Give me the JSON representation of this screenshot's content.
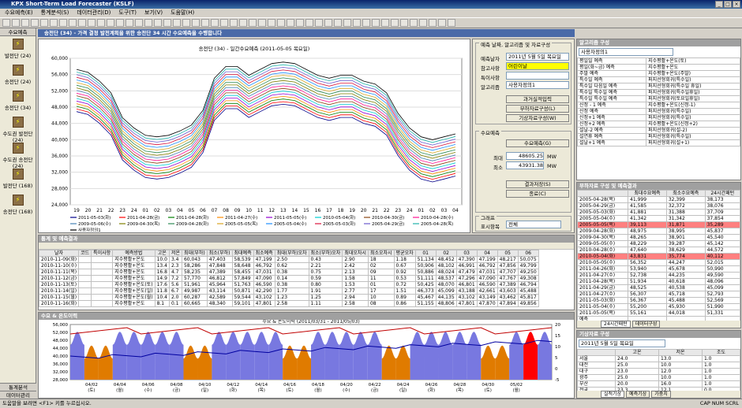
{
  "app": {
    "title": "KPX Short-Term Load Forecaster (KSLF)"
  },
  "menu": [
    "수요예측(E)",
    "통계분석(S)",
    "데이터관리(D)",
    "도구(T)",
    "보기(V)",
    "도움말(H)"
  ],
  "nav": {
    "header": "수요예측",
    "items": [
      "발전단 (24)",
      "송전단 (24)",
      "송전단 (34)",
      "수도권 발전단 (24)",
      "수도권 송전단 (24)",
      "발전단 (168)",
      "송전단 (168)"
    ],
    "footer": [
      "통계분석",
      "데이터관리"
    ]
  },
  "main": {
    "banner": "송전단 (34) - 가격 결정 발전계획을 위한 송전단 34 시간 수요예측을 수행합니다"
  },
  "chart1": {
    "title": "송전단 (34) - 일간수요예측 (2011-05-05 목요일)",
    "ylabels": [
      "24,000",
      "28,000",
      "32,000",
      "36,000",
      "40,000",
      "44,000",
      "48,000",
      "52,000",
      "56,000",
      "60,000"
    ],
    "xlabels": [
      "19",
      "20",
      "21",
      "22",
      "23",
      "24",
      "01",
      "02",
      "03",
      "04",
      "05",
      "06",
      "07",
      "08",
      "09",
      "10",
      "11",
      "12",
      "13",
      "14",
      "15",
      "16",
      "17",
      "18",
      "19",
      "20",
      "21",
      "22",
      "23",
      "24",
      "01",
      "02",
      "03",
      "04"
    ]
  },
  "legend": [
    "2011-05-03(화)",
    "2011-04-28(금)",
    "2011-04-28(화)",
    "2011-04-27(수)",
    "2011-05-05(수)",
    "2010-05-04(화)",
    "2010-04-30(금)",
    "2010-04-28(수)",
    "2009-05-06(수)",
    "2009-04-30(목)",
    "2009-04-28(화)",
    "2005-05-05(목)",
    "2005-05-04(수)",
    "2005-05-03(화)",
    "2005-04-29(금)",
    "2005-04-28(목)",
    "사용자정의1"
  ],
  "forecast_panel": {
    "title": "예측 날짜, 알고리즘 및 자료구성",
    "date_label": "예측날자",
    "date_value": "2011년  5월  5일 목요일",
    "ref_label": "참고사항",
    "ref_value": "어린이날",
    "special_label": "특이사항",
    "algo_label": "알고리즘",
    "algo_value": "사용자정의1",
    "btn_past": "과거실적입력",
    "btn_load": "부하자료구성(L)",
    "btn_temp": "기상자료구성(W)",
    "demand_title": "수요예측",
    "btn_demand": "수요예측(G)",
    "max_label": "최대",
    "max_value": "48605.25",
    "min_label": "최소",
    "min_value": "43931.38",
    "unit": "MW",
    "btn_save": "결과저장(S)",
    "btn_close": "종료(C)",
    "graph_title": "그래프",
    "display_label": "표시항목",
    "display_value": "전체"
  },
  "stats": {
    "title": "통계 및 예측결과",
    "headers": [
      "날자",
      "코드",
      "특이사항",
      "예측방법",
      "고온",
      "저온",
      "최대(부하)",
      "최소(부하)",
      "최대예측",
      "최소예측",
      "최대(부하)오차",
      "최소(부하)오차",
      "최대오차시",
      "최소오차시",
      "평균오차",
      "01",
      "02",
      "03",
      "04",
      "05",
      "06"
    ],
    "rows": [
      [
        "2010-11-09(화)",
        "",
        "",
        "지수평활+온도",
        "10.0",
        "3.4",
        "60,043",
        "47,403",
        "58,539",
        "47,199",
        "2.50",
        "0.43",
        "2.90",
        "18",
        "1.18",
        "51,134",
        "48,452",
        "47,390",
        "47,199",
        "48,217",
        "50,075"
      ],
      [
        "2010-11-10(수)",
        "",
        "",
        "지수평활+온도",
        "13.4",
        "2.3",
        "58,286",
        "47,848",
        "58,648",
        "46,792",
        "0.62",
        "2.21",
        "2.42",
        "02",
        "0.67",
        "50,906",
        "48,102",
        "46,991",
        "46,792",
        "47,856",
        "49,799"
      ],
      [
        "2010-11-11(목)",
        "",
        "",
        "지수평활+온도",
        "16.8",
        "4.7",
        "58,235",
        "47,389",
        "58,455",
        "47,031",
        "0.38",
        "0.75",
        "2.13",
        "09",
        "0.92",
        "50,886",
        "48,024",
        "47,479",
        "47,031",
        "47,707",
        "49,250"
      ],
      [
        "2010-11-12(금)",
        "",
        "",
        "지수평활+온도",
        "14.9",
        "7.2",
        "57,770",
        "46,812",
        "57,849",
        "47,090",
        "0.14",
        "0.59",
        "1.58",
        "11",
        "0.53",
        "51,111",
        "48,537",
        "47,296",
        "47,090",
        "47,767",
        "49,308"
      ],
      [
        "2010-11-13(토)",
        "",
        "",
        "지수평활+온도(토)",
        "17.6",
        "5.6",
        "51,961",
        "45,964",
        "51,763",
        "46,590",
        "0.38",
        "0.80",
        "1.53",
        "01",
        "0.72",
        "50,425",
        "48,070",
        "46,801",
        "46,590",
        "47,389",
        "46,794"
      ],
      [
        "2010-11-14(일)",
        "",
        "",
        "지수평활+온도(일)",
        "11.8",
        "6.7",
        "49,987",
        "43,114",
        "50,871",
        "42,290",
        "1.77",
        "1.91",
        "2.77",
        "17",
        "1.51",
        "46,373",
        "45,099",
        "43,188",
        "42,661",
        "43,603",
        "45,488"
      ],
      [
        "2010-11-15(월)",
        "",
        "",
        "지수평활+온도(월)",
        "10.4",
        "2.0",
        "60,287",
        "42,589",
        "59,544",
        "43,102",
        "1.23",
        "1.25",
        "2.94",
        "10",
        "0.89",
        "45,467",
        "44,135",
        "43,102",
        "43,149",
        "43,462",
        "45,817"
      ],
      [
        "2010-11-16(화)",
        "",
        "",
        "지수평활+온도",
        "8.1",
        "0.1",
        "60,665",
        "48,340",
        "59,101",
        "47,801",
        "2.58",
        "1.11",
        "2.58",
        "08",
        "0.86",
        "51,155",
        "48,806",
        "47,801",
        "47,870",
        "47,894",
        "49,856"
      ]
    ]
  },
  "chart2": {
    "title": "수요 & 온도이력 (2011/03/31 - 2011/05/03)",
    "ylabels": [
      "28,000",
      "32,000",
      "36,000",
      "40,000",
      "44,000",
      "48,000",
      "52,000",
      "56,000"
    ],
    "y2labels": [
      "-5",
      "0",
      "5",
      "10",
      "15",
      "20"
    ],
    "xlabels": [
      "04/02\n(토)",
      "04/04\n(월)",
      "04/06\n(수)",
      "04/08\n(금)",
      "04/10\n(일)",
      "04/12\n(화)",
      "04/14\n(목)",
      "04/16\n(토)",
      "04/18\n(월)",
      "04/20\n(수)",
      "04/22\n(금)",
      "04/24\n(일)",
      "04/26\n(화)",
      "04/28\n(목)",
      "04/30\n(토)",
      "05/02\n(월)"
    ]
  },
  "algo": {
    "title": "알고리즘 구성",
    "dropdown": "사용자정의1",
    "rows": [
      [
        "평일일 예측",
        "지수평활+온도(토)"
      ],
      [
        "평일(화~금) 예측",
        "지수평활+온도"
      ],
      [
        "주말 예측",
        "지수평활+온도(주말)"
      ],
      [
        "특수일 예측",
        "퍼지선형회귀(특수일)"
      ],
      [
        "특수일 다음일 예측",
        "퍼지선형회귀(특수일 휴일)"
      ],
      [
        "특수일 특수일 예측",
        "퍼지선형회귀(특수일휴일)"
      ],
      [
        "특수일 특수일 예측",
        "퍼지선형회귀(토요일휴일)"
      ],
      [
        "신정 - 1 예측",
        "지수평활+온도(신정-1)"
      ],
      [
        "신정 예측",
        "퍼지선형회귀(특수일)"
      ],
      [
        "신정+1 예측",
        "퍼지선형회귀(특수일)"
      ],
      [
        "신정+2 예측",
        "지수평활+온도(신정+2)"
      ],
      [
        "설날-2 예측",
        "퍼지선형회귀(설-2)"
      ],
      [
        "설연휴 예측",
        "퍼지선형회귀(특수일)"
      ],
      [
        "설날+1 예측",
        "퍼지선형회귀(설+1)"
      ]
    ]
  },
  "loaddata": {
    "title": "부하자료 구성 및 예측결과",
    "headers": [
      "",
      "최대수요예측",
      "최소수요예측",
      "24시간패턴"
    ],
    "rows": [
      [
        "2005-04-28(목)",
        "41,999",
        "32,399",
        "38,173"
      ],
      [
        "2005-04-29(금)",
        "41,585",
        "32,372",
        "38,076"
      ],
      [
        "2005-05-03(화)",
        "41,881",
        "31,388",
        "37,709"
      ],
      [
        "2005-05-04(수)",
        "41,342",
        "31,342",
        "37,854"
      ],
      [
        "2005-05-05(목)",
        "39,113",
        "31,871",
        "35,289"
      ],
      [
        "2009-04-28(화)",
        "48,975",
        "38,995",
        "45,837"
      ],
      [
        "2009-04-30(목)",
        "48,265",
        "38,901",
        "45,540"
      ],
      [
        "2009-05-05(수)",
        "48,229",
        "39,287",
        "45,142"
      ],
      [
        "2010-04-28(수)",
        "47,640",
        "38,629",
        "44,572"
      ],
      [
        "2010-05-04(화)",
        "43,831",
        "35,774",
        "40,112"
      ],
      [
        "2010-05-05(수)",
        "56,352",
        "44,247",
        "52,015"
      ],
      [
        "2011-04-26(화)",
        "53,940",
        "45,678",
        "50,990"
      ],
      [
        "2011-04-27(수)",
        "52,738",
        "44,235",
        "49,590"
      ],
      [
        "2011-04-28(목)",
        "51,934",
        "40,618",
        "48,096"
      ],
      [
        "2011-04-29(금)",
        "48,525",
        "40,538",
        "45,099"
      ],
      [
        "2011-04-27(수)",
        "56,307",
        "45,718",
        "52,793"
      ],
      [
        "2011-05-03(화)",
        "56,367",
        "45,488",
        "52,569"
      ],
      [
        "2011-05-04(수)",
        "55,200",
        "45,930",
        "51,990"
      ],
      [
        "2011-05-05(목)",
        "55,161",
        "44,018",
        "51,331"
      ],
      [
        "예측",
        "",
        "",
        ""
      ]
    ],
    "tabs": [
      "24시간패턴",
      "데이터구성"
    ]
  },
  "weather": {
    "title": "기상자료 구성",
    "date": "2011년  5월  5일 목요일",
    "headers": [
      "",
      "고온",
      "저온",
      "조도"
    ],
    "rows": [
      [
        "서울",
        "24.0",
        "13.0",
        "1.0"
      ],
      [
        "대전",
        "25.0",
        "10.0",
        "1.0"
      ],
      [
        "대구",
        "23.0",
        "12.0",
        "1.0"
      ],
      [
        "광주",
        "25.0",
        "10.0",
        "1.0"
      ],
      [
        "부산",
        "20.0",
        "16.0",
        "1.0"
      ],
      [
        "전국",
        "23.3",
        "12.1",
        "0.0"
      ]
    ],
    "tabs": [
      "실적기상",
      "예측기상",
      "가중치"
    ]
  },
  "status": {
    "text": "도움말을 보려면 <F1> 키를 누르십시오.",
    "right": "CAP  NUM  SCRL"
  }
}
